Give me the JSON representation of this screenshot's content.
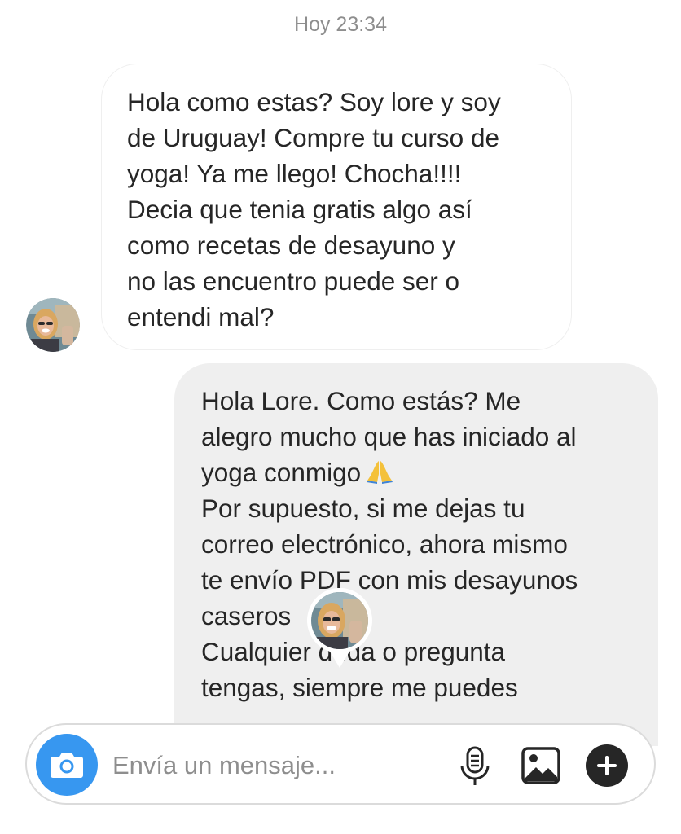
{
  "timestamp": "Hoy 23:34",
  "incoming_message": {
    "lines": [
      "Hola como estas? Soy lore y soy",
      "de Uruguay! Compre tu curso de",
      "yoga! Ya me llego! Chocha!!!!",
      "Decia que tenia gratis algo así",
      "como recetas de desayuno y",
      "no las encuentro puede ser o",
      "entendi mal?"
    ]
  },
  "outgoing_message": {
    "lines": [
      "Hola Lore. Como estás? Me",
      "alegro mucho que has iniciado al",
      "yoga conmigo",
      "Por supuesto, si me dejas tu",
      "correo electrónico, ahora mismo",
      "te envío PDF con mis desayunos",
      "caseros",
      "Cualquier duda o pregunta",
      "tengas, siempre me puedes"
    ],
    "emoji": "folded-hands-emoji"
  },
  "composer": {
    "placeholder": "Envía un mensaje..."
  },
  "icons": {
    "camera": "camera-icon",
    "mic": "microphone-icon",
    "gallery": "image-gallery-icon",
    "plus": "plus-icon",
    "avatar": "user-avatar",
    "seen": "seen-avatar-marker"
  },
  "colors": {
    "camera_button": "#3797f0",
    "outgoing_bubble": "#efefef",
    "timestamp_text": "#8e8e8e"
  }
}
